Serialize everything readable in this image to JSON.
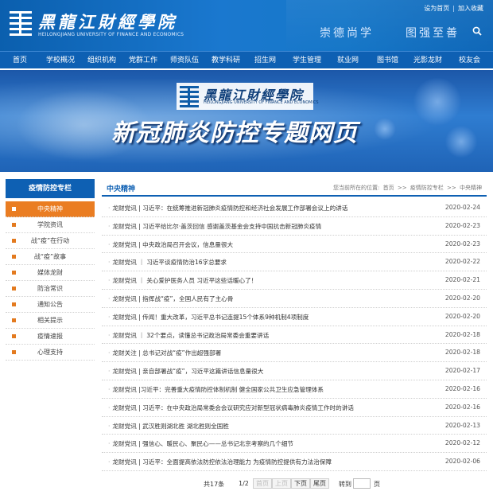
{
  "header": {
    "school_name_cn": "黑龍江財經學院",
    "school_name_en": "HEILONGJIANG UNIVERSITY OF FINANCE AND ECONOMICS",
    "top_links": [
      "设为首页",
      "加入收藏"
    ],
    "motto_left": "崇德尚学",
    "motto_right": "图强至善",
    "colors": {
      "primary": "#0e60b3",
      "accent": "#ea7d22"
    }
  },
  "nav": {
    "items": [
      "首页",
      "学校概况",
      "组织机构",
      "党群工作",
      "师资队伍",
      "教学科研",
      "招生网",
      "学生管理",
      "就业网",
      "图书馆",
      "光影龙财",
      "校友会"
    ]
  },
  "banner": {
    "school_name_cn": "黑龍江財經學院",
    "school_name_en": "HEILONGJIANG UNIVERSITY OF FINANCE AND ECONOMICS",
    "title": "新冠肺炎防控专题网页"
  },
  "sidebar": {
    "heading": "疫情防控专栏",
    "items": [
      {
        "label": "中央精神",
        "active": true
      },
      {
        "label": "学院资讯",
        "active": false
      },
      {
        "label": "战“疫”在行动",
        "active": false
      },
      {
        "label": "战“疫”故事",
        "active": false
      },
      {
        "label": "媒体龙财",
        "active": false
      },
      {
        "label": "防治常识",
        "active": false
      },
      {
        "label": "通知公告",
        "active": false
      },
      {
        "label": "相关提示",
        "active": false
      },
      {
        "label": "疫情速报",
        "active": false
      },
      {
        "label": "心理支持",
        "active": false
      }
    ]
  },
  "main": {
    "title": "中央精神",
    "breadcrumb": {
      "prefix": "您当前所在的位置:",
      "items": [
        "首页",
        ">>",
        "疫情防控专栏",
        ">>",
        "中央精神"
      ]
    },
    "bullet": "·",
    "news": [
      {
        "title": "龙财党讯 | 习近平：在统筹推进新冠肺炎疫情防控和经济社会发展工作部署会议上的讲话",
        "date": "2020-02-24"
      },
      {
        "title": "龙财党讯 | 习近平给比尔·盖茨回信 感谢盖茨基金会支持中国抗击新冠肺炎疫情",
        "date": "2020-02-23"
      },
      {
        "title": "龙财党讯 | 中央政治局召开会议，信息量很大",
        "date": "2020-02-23"
      },
      {
        "title": "龙财党讯 ｜ 习近平谈疫情防治16字总要求",
        "date": "2020-02-22"
      },
      {
        "title": "龙财党讯 ｜ 关心爱护医务人员 习近平这些话暖心了！",
        "date": "2020-02-21"
      },
      {
        "title": "龙财党讯 | 指挥战“疫”，全国人民有了主心骨",
        "date": "2020-02-20"
      },
      {
        "title": "龙财党讯 | 传闻！重大改革，习近平总书记连提15个体系9种机制4项制度",
        "date": "2020-02-20"
      },
      {
        "title": "龙财党讯 ｜ 32个要点，读懂总书记政治局常委会重要讲话",
        "date": "2020-02-18"
      },
      {
        "title": "龙财关注 | 总书记对战“疫”作出超强部署",
        "date": "2020-02-18"
      },
      {
        "title": "龙财党讯 | 亲自部署战“疫”，习近平这篇讲话信息量很大",
        "date": "2020-02-17"
      },
      {
        "title": "龙财党讯 |习近平：完善重大疫情防控体制机制 健全国家公共卫生应急管理体系",
        "date": "2020-02-16"
      },
      {
        "title": "龙财党讯 | 习近平：在中央政治局常委会会议研究应对新型冠状病毒肺炎疫情工作时的讲话",
        "date": "2020-02-16"
      },
      {
        "title": "龙财党讯 | 武汉胜则湖北胜 湖北胜则全国胜",
        "date": "2020-02-13"
      },
      {
        "title": "龙财党讯 | 强信心、暖民心、聚民心——总书记北京考察的几个细节",
        "date": "2020-02-12"
      },
      {
        "title": "龙财党讯 | 习近平：全面提高依法防控依法治理能力 为疫情防控提供有力法治保障",
        "date": "2020-02-06"
      }
    ]
  },
  "pager": {
    "total": "共17条",
    "page": "1/2",
    "first": "首页",
    "prev": "上页",
    "next": "下页",
    "last": "尾页",
    "goto_label": "转到",
    "page_unit": "页",
    "goto_value": ""
  }
}
